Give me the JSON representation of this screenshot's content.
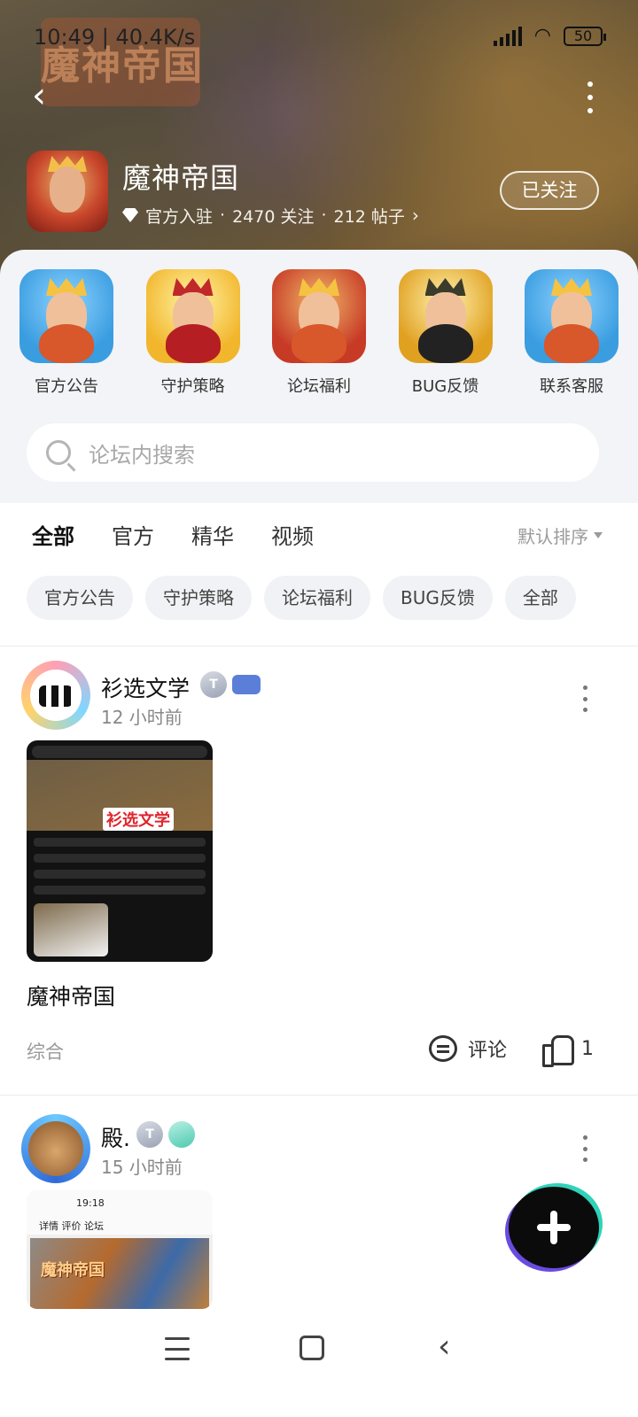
{
  "status_bar": {
    "time": "10:49 | 40.4K/s",
    "battery": "50"
  },
  "header": {
    "banner_logo_text": "魔神帝国",
    "game_name": "魔神帝国",
    "meta": {
      "official": "官方入驻",
      "followers": "2470 关注",
      "posts": "212 帖子",
      "separator": "·"
    },
    "follow_button": "已关注"
  },
  "shortcuts": [
    {
      "label": "官方公告",
      "icon": "king-avatar-icon"
    },
    {
      "label": "守护策略",
      "icon": "warrior-avatar-icon"
    },
    {
      "label": "论坛福利",
      "icon": "king-avatar-icon"
    },
    {
      "label": "BUG反馈",
      "icon": "general-avatar-icon"
    },
    {
      "label": "联系客服",
      "icon": "king-avatar-icon"
    }
  ],
  "search": {
    "placeholder": "论坛内搜索"
  },
  "tabs": [
    {
      "label": "全部",
      "active": true
    },
    {
      "label": "官方",
      "active": false
    },
    {
      "label": "精华",
      "active": false
    },
    {
      "label": "视频",
      "active": false
    }
  ],
  "sort": "默认排序",
  "chips": [
    "官方公告",
    "守护策略",
    "论坛福利",
    "BUG反馈",
    "全部"
  ],
  "posts": [
    {
      "user": "衫选文学",
      "time": "12 小时前",
      "image_overlay_text": "衫选文学",
      "title": "魔神帝国",
      "tag": "综合",
      "comment_label": "评论",
      "likes": "1",
      "badge": "T"
    },
    {
      "user": "殿.",
      "time": "15 小时前",
      "image_time": "19:18",
      "image_tabs": "详情  评价  论坛",
      "image_title": "魔神帝国",
      "badge": "T"
    }
  ],
  "colors": {
    "accent": "#2fd3b8",
    "fab_glow": "#6a4be0"
  }
}
